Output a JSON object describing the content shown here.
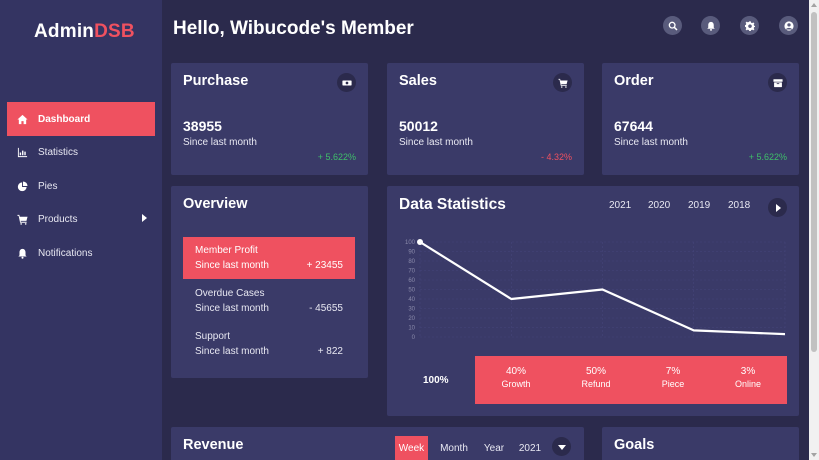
{
  "sidebar": {
    "logo_main": "Admin",
    "logo_accent": "DSB",
    "items": [
      {
        "label": "Dashboard",
        "icon": "home-icon"
      },
      {
        "label": "Statistics",
        "icon": "chart-icon"
      },
      {
        "label": "Pies",
        "icon": "pie-icon"
      },
      {
        "label": "Products",
        "icon": "cart-icon"
      },
      {
        "label": "Notifications",
        "icon": "bell-icon"
      }
    ]
  },
  "header": {
    "greeting": "Hello, Wibucode's Member",
    "icons": [
      "search-icon",
      "bell-icon",
      "gear-icon",
      "user-icon"
    ]
  },
  "cards": {
    "purchase": {
      "title": "Purchase",
      "value": "38955",
      "sub": "Since last month",
      "change": "+ 5.622%",
      "icon": "money-icon"
    },
    "sales": {
      "title": "Sales",
      "value": "50012",
      "sub": "Since last month",
      "change": "- 4.32%",
      "icon": "cart-icon"
    },
    "order": {
      "title": "Order",
      "value": "67644",
      "sub": "Since last month",
      "change": "+ 5.622%",
      "icon": "box-icon"
    }
  },
  "overview": {
    "title": "Overview",
    "items": [
      {
        "label": "Member Profit",
        "sub": "Since last month",
        "value": "+ 23455"
      },
      {
        "label": "Overdue Cases",
        "sub": "Since last month",
        "value": "- 45655"
      },
      {
        "label": "Support",
        "sub": "Since last month",
        "value": "+ 822"
      }
    ]
  },
  "data_statistics": {
    "title": "Data Statistics",
    "years": [
      "2021",
      "2020",
      "2019",
      "2018"
    ],
    "total": "100%",
    "band": [
      {
        "value": "40%",
        "label": "Growth"
      },
      {
        "value": "50%",
        "label": "Refund"
      },
      {
        "value": "7%",
        "label": "Piece"
      },
      {
        "value": "3%",
        "label": "Online"
      }
    ]
  },
  "chart_data": {
    "type": "line",
    "x": [
      1,
      2,
      3,
      4,
      5
    ],
    "y": [
      100,
      40,
      50,
      7,
      3
    ],
    "ylim": [
      0,
      100
    ],
    "yticks": [
      0,
      10,
      20,
      30,
      40,
      50,
      60,
      70,
      80,
      90,
      100
    ],
    "grid": true,
    "line_color": "#ffffff"
  },
  "revenue": {
    "title": "Revenue",
    "tabs": [
      "Week",
      "Month",
      "Year"
    ],
    "year": "2021"
  },
  "goals": {
    "title": "Goals"
  },
  "colors": {
    "accent": "#ef5160",
    "background": "#2b2a4c",
    "card": "#3a3a68",
    "sidebar": "#343462",
    "positive": "#3fbf6a",
    "negative": "#ef5160"
  }
}
